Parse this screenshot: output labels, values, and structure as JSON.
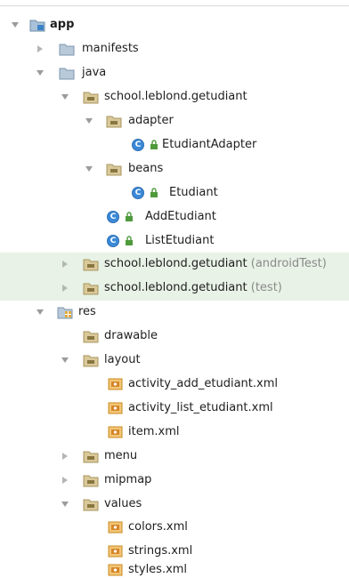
{
  "tree": {
    "app": "app",
    "manifests": "manifests",
    "java": "java",
    "pkg_main": "school.leblond.getudiant",
    "adapter": "adapter",
    "etudiant_adapter": "EtudiantAdapter",
    "beans": "beans",
    "etudiant": "Etudiant",
    "add_etudiant": "AddEtudiant",
    "list_etudiant": "ListEtudiant",
    "pkg_android_test": "school.leblond.getudiant",
    "android_test_suffix": "(androidTest)",
    "pkg_test": "school.leblond.getudiant",
    "test_suffix": "(test)",
    "res": "res",
    "drawable": "drawable",
    "layout": "layout",
    "activity_add": "activity_add_etudiant.xml",
    "activity_list": "activity_list_etudiant.xml",
    "item_xml": "item.xml",
    "menu": "menu",
    "mipmap": "mipmap",
    "values": "values",
    "colors": "colors.xml",
    "strings": "strings.xml",
    "styles": "styles.xml",
    "class_glyph": "C"
  },
  "colors": {
    "highlight_bg": "#e8f2e6",
    "folder": "#b8c9d9",
    "package_folder": "#c4b07a",
    "class_badge": "#3b89d8",
    "xml_icon": "#e8a23c",
    "muted_text": "#8a8a8a"
  },
  "icons": {
    "expanded": "triangle-down-icon",
    "collapsed": "triangle-right-icon",
    "module": "module-folder-icon",
    "folder": "folder-icon",
    "package": "package-folder-icon",
    "class": "class-c-icon",
    "lock": "lock-icon",
    "xml": "xml-file-icon"
  }
}
